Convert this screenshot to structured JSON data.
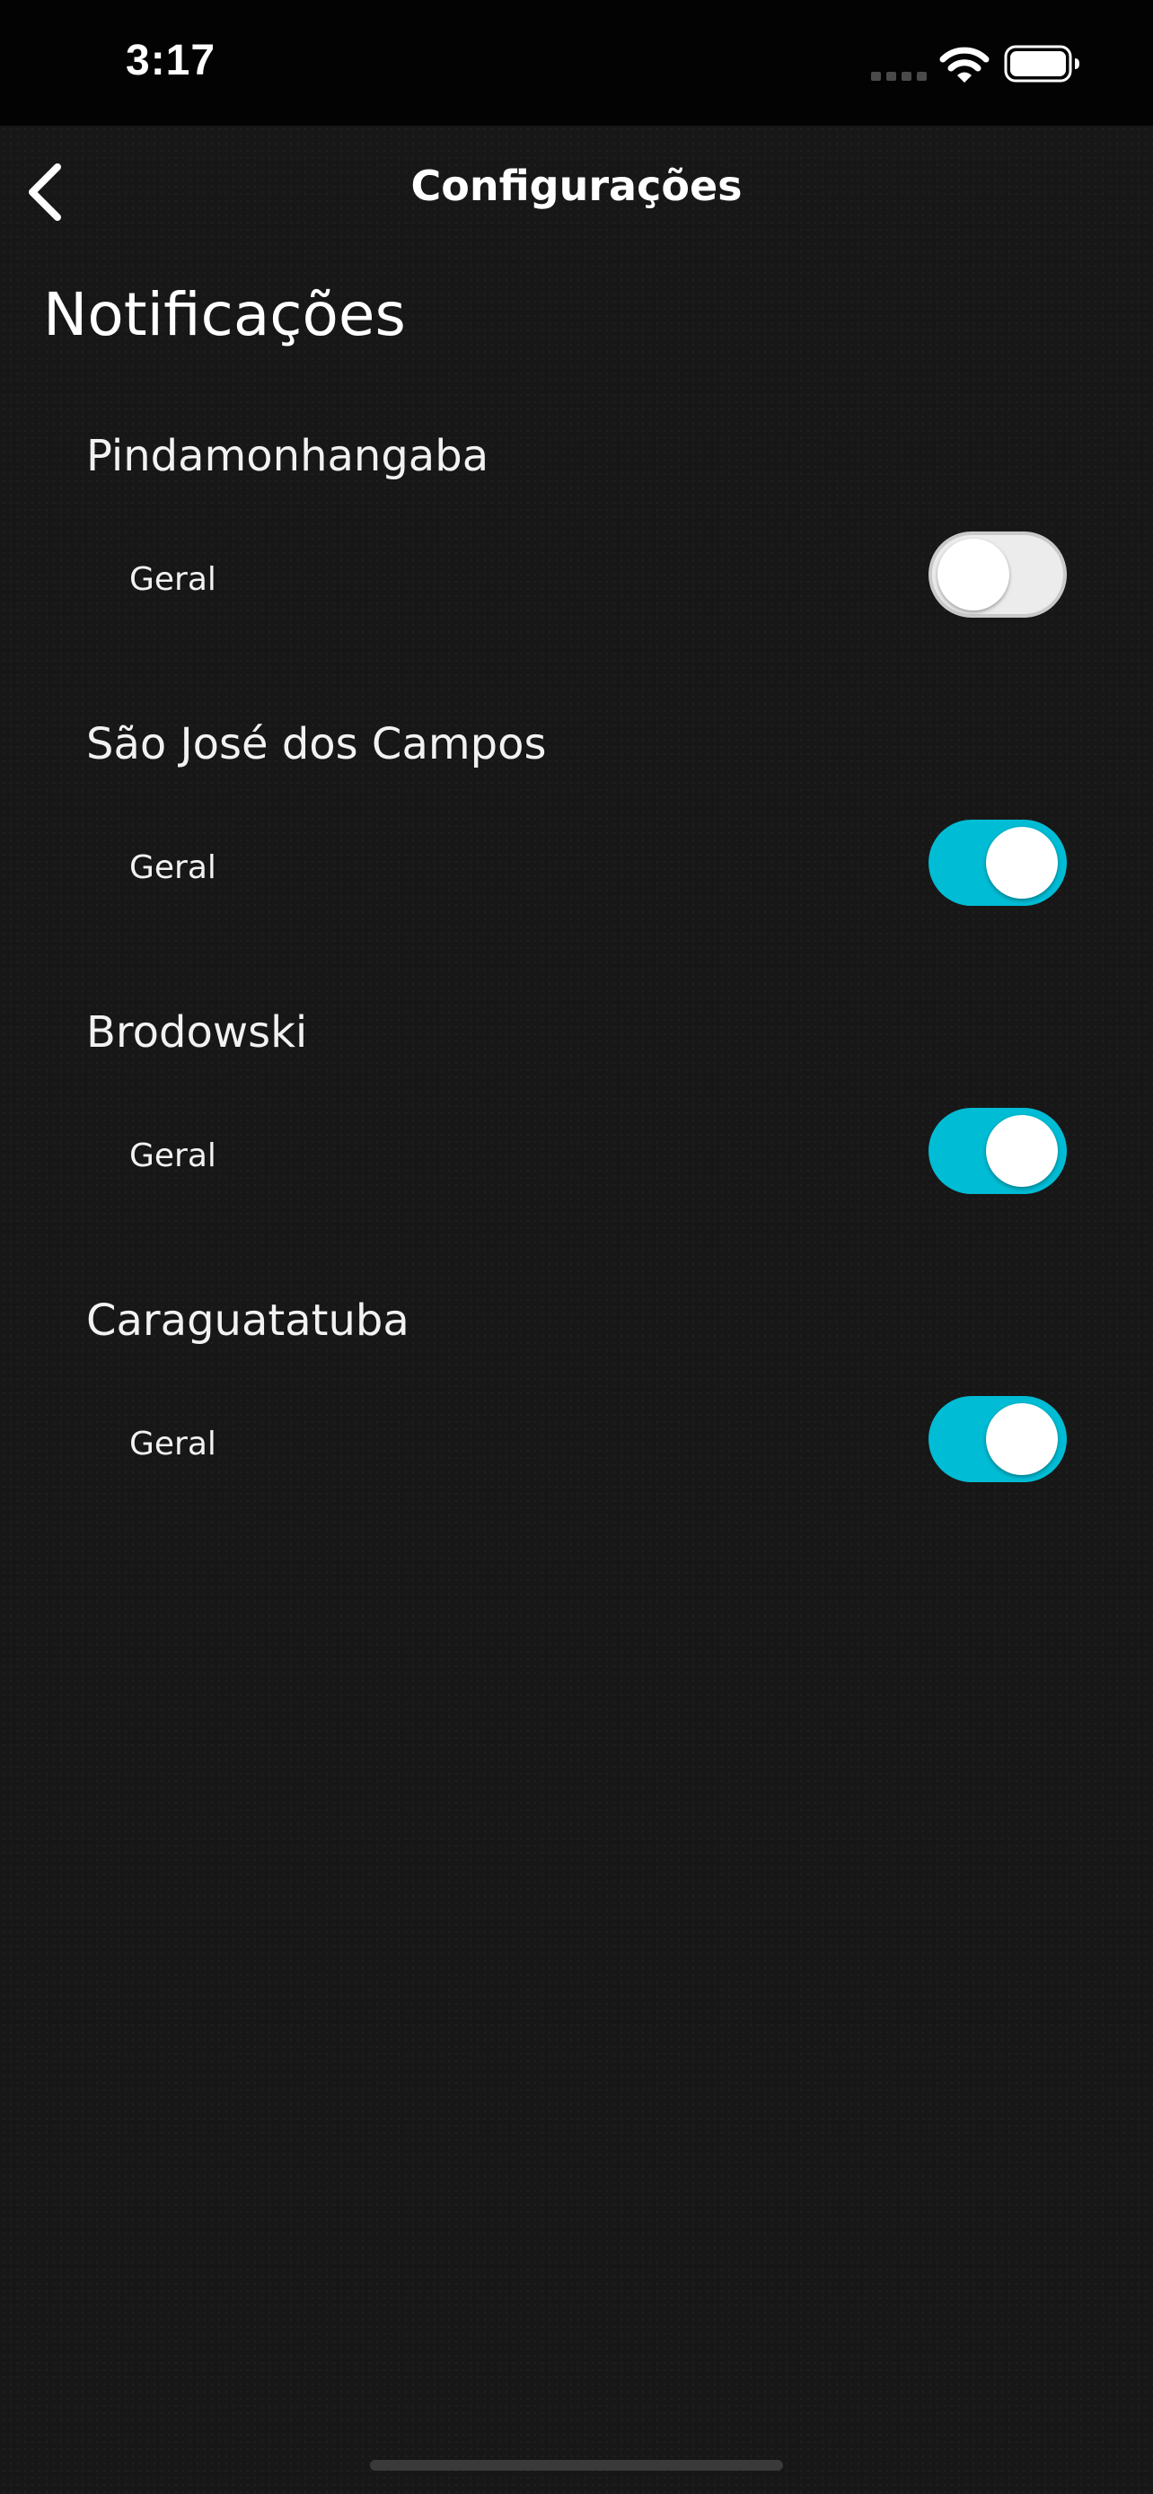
{
  "status_bar": {
    "time": "3:17",
    "icons": [
      "signal-icon",
      "wifi-icon",
      "battery-icon"
    ]
  },
  "nav": {
    "back_icon": "chevron-left-icon",
    "title": "Configurações"
  },
  "section": {
    "title": "Notificações"
  },
  "groups": [
    {
      "title": "Pindamonhangaba",
      "row_label": "Geral",
      "enabled": false
    },
    {
      "title": "São José dos Campos",
      "row_label": "Geral",
      "enabled": true
    },
    {
      "title": "Brodowski",
      "row_label": "Geral",
      "enabled": true
    },
    {
      "title": "Caraguatatuba",
      "row_label": "Geral",
      "enabled": true
    }
  ],
  "colors": {
    "toggle_on": "#00bcd4",
    "toggle_off": "#ececec",
    "background": "#171717",
    "status_bar": "#030303"
  }
}
